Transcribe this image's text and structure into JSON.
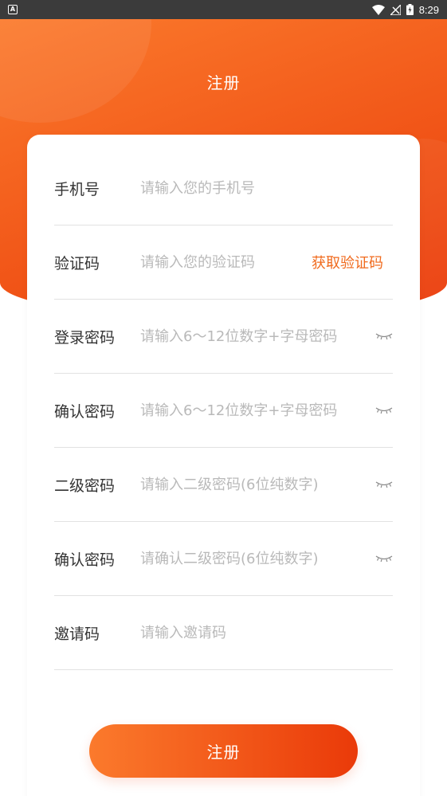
{
  "status_bar": {
    "notification_icon": "A",
    "time": "8:29"
  },
  "header": {
    "title": "注册"
  },
  "form": {
    "fields": [
      {
        "label": "手机号",
        "placeholder": "请输入您的手机号",
        "value": ""
      },
      {
        "label": "验证码",
        "placeholder": "请输入您的验证码",
        "value": "",
        "action": "获取验证码"
      },
      {
        "label": "登录密码",
        "placeholder": "请输入6～12位数字+字母密码",
        "value": "",
        "icon": "eye-closed-icon"
      },
      {
        "label": "确认密码",
        "placeholder": "请输入6～12位数字+字母密码",
        "value": "",
        "icon": "eye-closed-icon"
      },
      {
        "label": "二级密码",
        "placeholder": "请输入二级密码(6位纯数字)",
        "value": "",
        "icon": "eye-closed-icon"
      },
      {
        "label": "确认密码",
        "placeholder": "请确认二级密码(6位纯数字)",
        "value": "",
        "icon": "eye-closed-icon"
      },
      {
        "label": "邀请码",
        "placeholder": "请输入邀请码",
        "value": ""
      }
    ]
  },
  "submit": {
    "label": "注册"
  },
  "colors": {
    "accent": "#f35d1c",
    "accent_light": "#fb7a2c",
    "accent_dark": "#ea3a09",
    "link": "#f06a1d"
  }
}
